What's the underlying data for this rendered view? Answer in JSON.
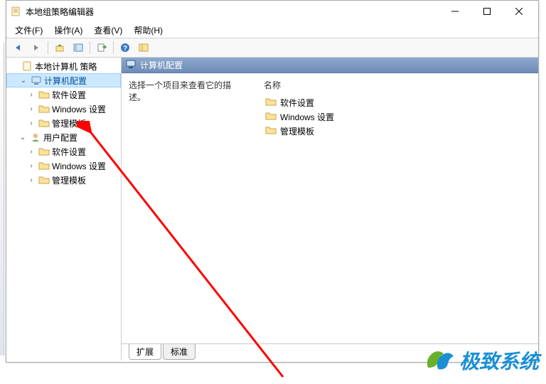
{
  "window": {
    "title": "本地组策略编辑器"
  },
  "menu": {
    "file": "文件(F)",
    "action": "操作(A)",
    "view": "查看(V)",
    "help": "帮助(H)"
  },
  "tree": {
    "root": "本地计算机 策略",
    "computer_config": "计算机配置",
    "software_settings": "软件设置",
    "windows_settings": "Windows 设置",
    "admin_templates": "管理模板",
    "user_config": "用户配置"
  },
  "right": {
    "header": "计算机配置",
    "description": "选择一个项目来查看它的描述。",
    "column_name": "名称",
    "items": {
      "software": "软件设置",
      "windows": "Windows 设置",
      "templates": "管理模板"
    }
  },
  "tabs": {
    "extended": "扩展",
    "standard": "标准"
  },
  "logo_text": "极致系统"
}
